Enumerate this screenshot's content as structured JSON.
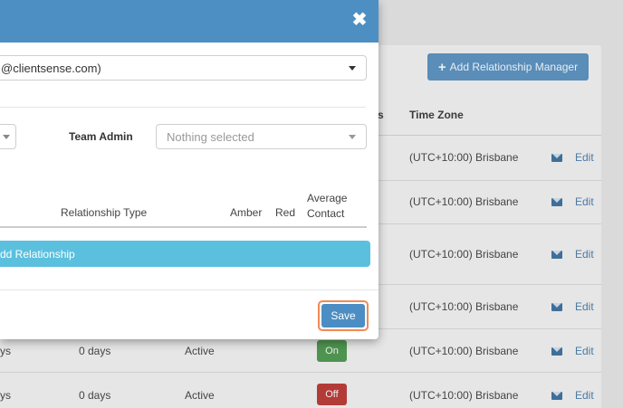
{
  "background": {
    "add_manager_label": "Add Relationship Manager",
    "add_manager_icon": "plus-icon",
    "col_partial": "s",
    "col_timezone": "Time Zone",
    "rows": [
      {
        "tz": "(UTC+10:00) Brisbane",
        "edit": "Edit"
      },
      {
        "tz": "(UTC+10:00) Brisbane",
        "edit": "Edit"
      },
      {
        "tz": "(UTC+10:00) Brisbane",
        "edit": "Edit"
      },
      {
        "tz": "(UTC+10:00) Brisbane",
        "edit": "Edit"
      },
      {
        "tz": "(UTC+10:00) Brisbane",
        "edit": "Edit",
        "col1": "ys",
        "days": "0 days",
        "status": "Active",
        "toggle": "On"
      },
      {
        "tz": "(UTC+10:00) Brisbane",
        "edit": "Edit",
        "col1": "ys",
        "days": "0 days",
        "status": "Active",
        "toggle": "Off"
      }
    ]
  },
  "modal": {
    "close_icon": "close-icon",
    "email_select_value": "@clientsense.com)",
    "team_admin_label": "Team Admin",
    "team_admin_placeholder": "Nothing selected",
    "table_headers": {
      "relationship_type": "Relationship Type",
      "amber": "Amber",
      "red": "Red",
      "average_line1": "Average",
      "average_line2": "Contact"
    },
    "add_relationship_label": "dd Relationship",
    "save_label": "Save"
  },
  "colors": {
    "modal_header": "#4d8fc2",
    "info_bar": "#5bc0de",
    "save_highlight": "#f08a55",
    "toggle_on": "#4e9350",
    "toggle_off": "#b33b37"
  }
}
